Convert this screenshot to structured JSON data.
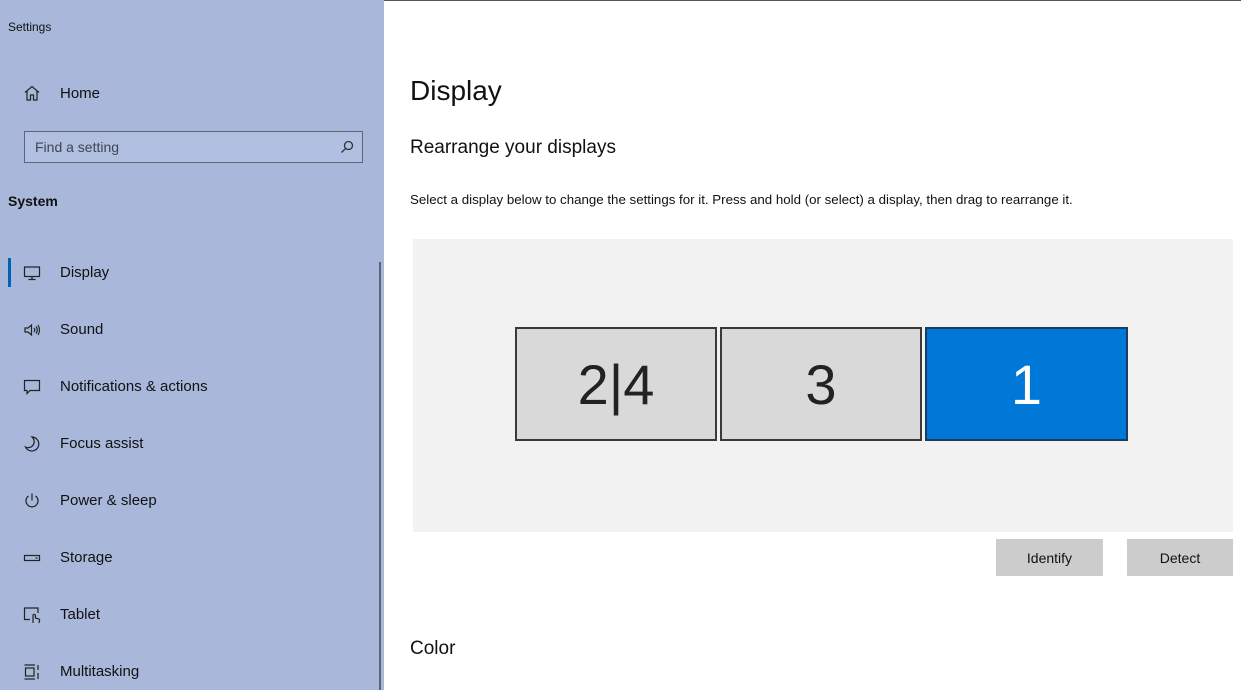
{
  "app": {
    "title": "Settings"
  },
  "sidebar": {
    "home_label": "Home",
    "search_placeholder": "Find a setting",
    "section_header": "System",
    "items": [
      {
        "label": "Display",
        "icon": "monitor-icon",
        "selected": true
      },
      {
        "label": "Sound",
        "icon": "speaker-icon"
      },
      {
        "label": "Notifications & actions",
        "icon": "notification-icon"
      },
      {
        "label": "Focus assist",
        "icon": "moon-icon"
      },
      {
        "label": "Power & sleep",
        "icon": "power-icon"
      },
      {
        "label": "Storage",
        "icon": "storage-icon"
      },
      {
        "label": "Tablet",
        "icon": "tablet-icon"
      },
      {
        "label": "Multitasking",
        "icon": "multitasking-icon"
      }
    ]
  },
  "main": {
    "page_title": "Display",
    "section_title": "Rearrange your displays",
    "description": "Select a display below to change the settings for it. Press and hold (or select) a display, then drag to rearrange it.",
    "monitors": [
      {
        "label": "2|4",
        "active": false
      },
      {
        "label": "3",
        "active": false
      },
      {
        "label": "1",
        "active": true
      }
    ],
    "identify_label": "Identify",
    "detect_label": "Detect",
    "color_title": "Color"
  },
  "colors": {
    "sidebar_bg": "#a8b7da",
    "accent": "#0078d7",
    "display_area_bg": "#f2f2f2",
    "button_bg": "#cccccc"
  }
}
